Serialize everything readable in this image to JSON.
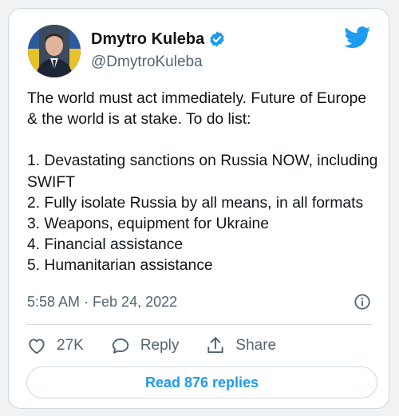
{
  "author": {
    "name": "Dmytro Kuleba",
    "handle": "@DmytroKuleba",
    "verified": true
  },
  "tweet": {
    "intro": "The world must act immediately. Future of Europe & the world is at stake. To do list:",
    "list": [
      "1. Devastating sanctions on Russia NOW, including SWIFT",
      "2. Fully isolate Russia by all means, in all formats",
      "3. Weapons, equipment for Ukraine",
      "4. Financial assistance",
      "5. Humanitarian assistance"
    ],
    "timestamp": "5:58 AM · Feb 24, 2022"
  },
  "actions": {
    "like_count": "27K",
    "reply_label": "Reply",
    "share_label": "Share"
  },
  "read_replies_label": "Read 876 replies",
  "colors": {
    "accent": "#1d9bf0",
    "text": "#0f1419",
    "secondary": "#536471",
    "border": "#cfd9de"
  },
  "icons": [
    "verified-badge-icon",
    "twitter-bird-icon",
    "info-icon",
    "heart-icon",
    "reply-icon",
    "share-icon"
  ]
}
